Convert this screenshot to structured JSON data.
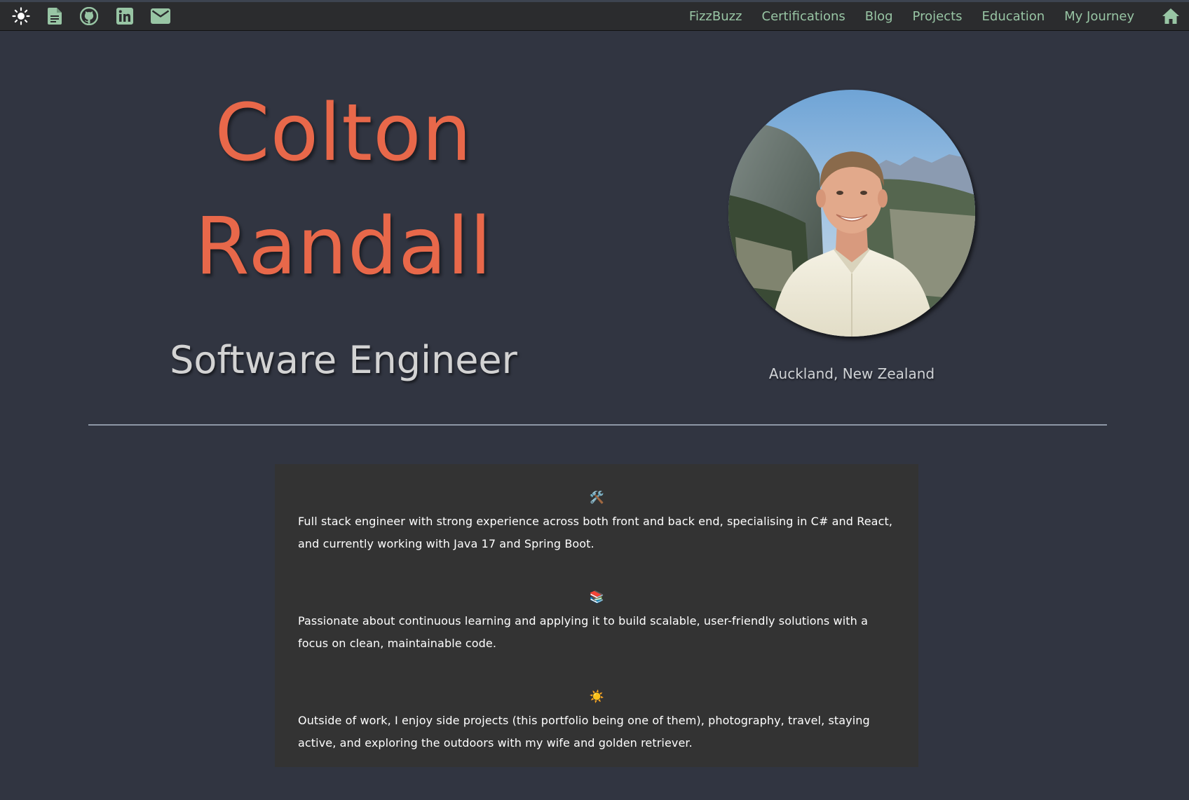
{
  "nav": {
    "left_icons": [
      "sun-icon",
      "document-icon",
      "github-icon",
      "linkedin-icon",
      "email-icon"
    ],
    "links": [
      {
        "label": "FizzBuzz"
      },
      {
        "label": "Certifications"
      },
      {
        "label": "Blog"
      },
      {
        "label": "Projects"
      },
      {
        "label": "Education"
      },
      {
        "label": "My Journey"
      }
    ],
    "home_icon": "home-icon"
  },
  "hero": {
    "first_name": "Colton",
    "last_name": "Randall",
    "role": "Software Engineer",
    "location": "Auckland, New Zealand",
    "photo": "profile-photo"
  },
  "about": {
    "items": [
      {
        "emoji": "🛠️",
        "text": "Full stack engineer with strong experience across both front and back end, specialising in C# and React, and currently working with Java 17 and Spring Boot."
      },
      {
        "emoji": "📚",
        "text": "Passionate about continuous learning and applying it to build scalable, user-friendly solutions with a focus on clean, maintainable code."
      },
      {
        "emoji": "☀️",
        "text": "Outside of work, I enjoy side projects (this portfolio being one of them), photography, travel, staying active, and exploring the outdoors with my wife and golden retriever."
      }
    ]
  },
  "colors": {
    "background": "#313541",
    "navbar": "#2b2c2e",
    "nav_accent": "#98c5a4",
    "name_accent": "#e8684a",
    "card": "#333333"
  }
}
